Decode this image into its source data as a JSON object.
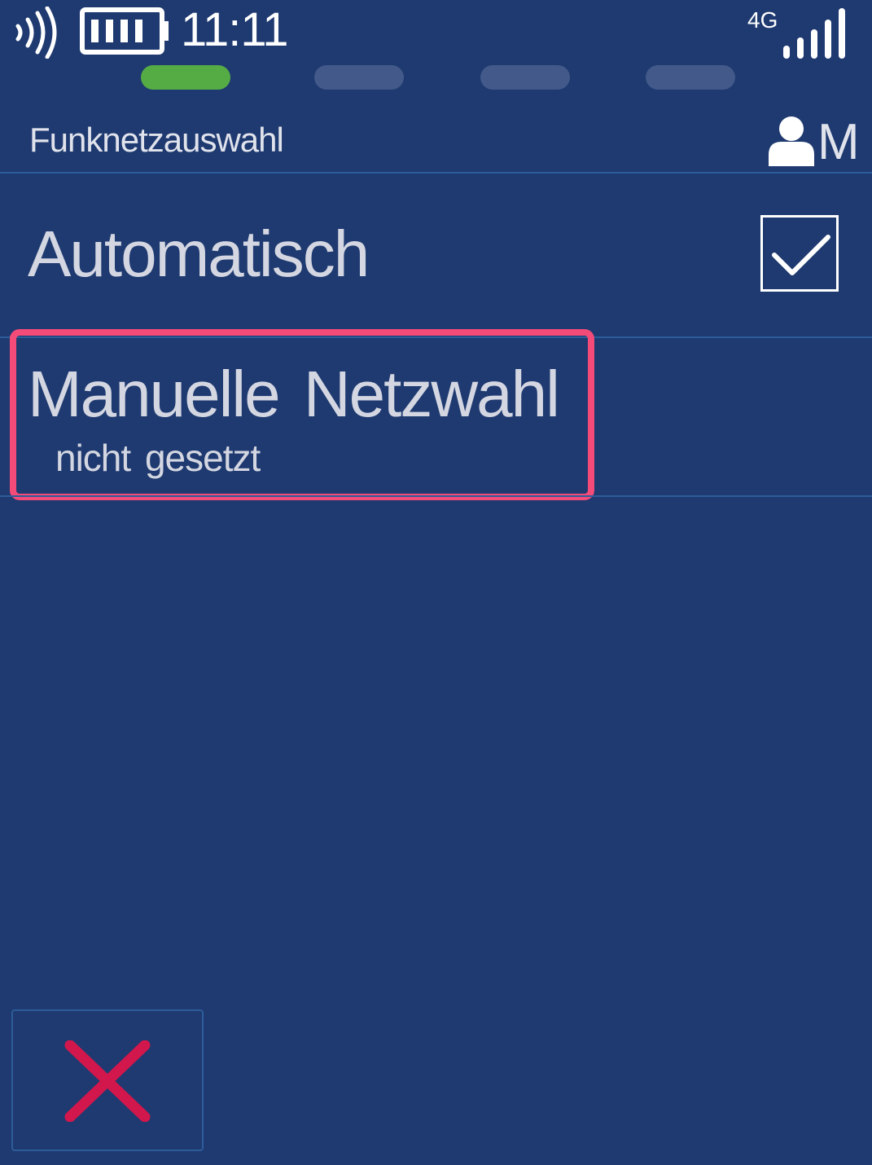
{
  "status_bar": {
    "time": "11:11",
    "network_type": "4G",
    "icons": [
      "nfc-icon",
      "battery-icon",
      "signal-icon"
    ]
  },
  "page_indicators": {
    "count": 4,
    "active_index": 0,
    "active_color": "#55ac44"
  },
  "header": {
    "title": "Funknetzauswahl",
    "user_mode": "M",
    "icon": "user-icon"
  },
  "items": [
    {
      "label": "Automatisch",
      "checked": true
    },
    {
      "label": "Manuelle Netzwahl",
      "sublabel": "nicht gesetzt",
      "focused": true
    }
  ],
  "footer": {
    "cancel_icon": "close-icon",
    "cancel_color": "#d2174c"
  },
  "colors": {
    "background": "#1f3a70",
    "focus_border": "#f54b78"
  }
}
